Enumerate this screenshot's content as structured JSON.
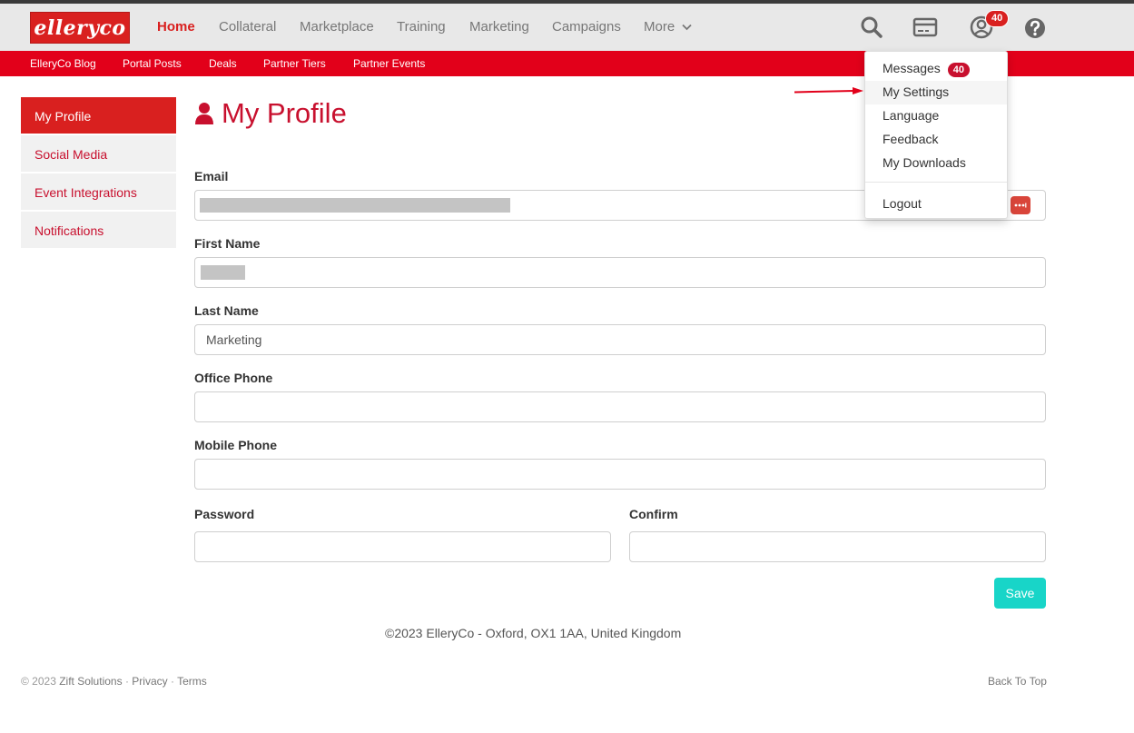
{
  "brand": {
    "logo_text": "elleryco",
    "accent": "#d9201f",
    "subnav_color": "#e2001a",
    "save_color": "#18d5c8"
  },
  "nav": {
    "items": [
      "Home",
      "Collateral",
      "Marketplace",
      "Training",
      "Marketing",
      "Campaigns",
      "More"
    ],
    "active": "Home",
    "icons": [
      "search-icon",
      "card-icon",
      "user-icon",
      "help-icon"
    ],
    "notification_count": "40"
  },
  "subnav": {
    "items": [
      "ElleryCo Blog",
      "Portal Posts",
      "Deals",
      "Partner Tiers",
      "Partner Events"
    ]
  },
  "sidebar": {
    "items": [
      "My Profile",
      "Social Media",
      "Event Integrations",
      "Notifications"
    ],
    "active": "My Profile"
  },
  "page": {
    "title": "My Profile",
    "icon": "user-icon"
  },
  "form": {
    "email_label": "Email",
    "first_name_label": "First Name",
    "last_name_label": "Last Name",
    "last_name_value": "Marketing",
    "office_phone_label": "Office Phone",
    "mobile_phone_label": "Mobile Phone",
    "password_label": "Password",
    "confirm_label": "Confirm",
    "save_label": "Save"
  },
  "dropdown": {
    "items": [
      "Messages",
      "My Settings",
      "Language",
      "Feedback",
      "My Downloads",
      "Logout"
    ],
    "messages_badge": "40",
    "highlighted": "My Settings"
  },
  "footer": {
    "copyright": "©2023 ElleryCo - Oxford, OX1 1AA, United Kingdom",
    "legal_prefix": "© 2023",
    "legal_company": "Zift Solutions",
    "privacy": "Privacy",
    "terms": "Terms",
    "back_to_top": "Back To Top"
  }
}
